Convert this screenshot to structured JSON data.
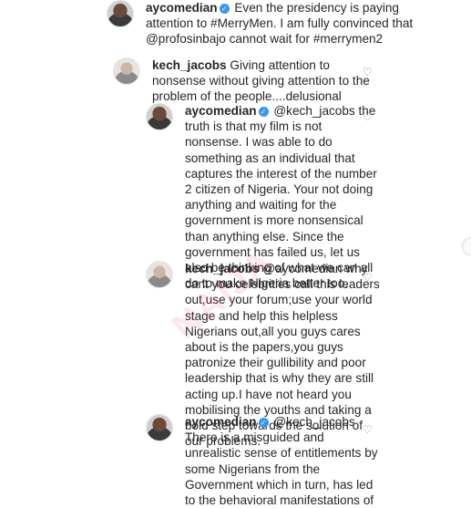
{
  "post": {
    "username": "aycomedian",
    "text": "Even the presidency is paying attention to #MerryMen. I am fully convinced that @profosinbajo cannot wait for #merrymen2"
  },
  "comments": [
    {
      "username": "kech_jacobs",
      "text": "Giving attention to nonsense without giving attention to the problem of the people....delusional"
    },
    {
      "username": "aycomedian",
      "text": "@kech_jacobs the truth is that my film is not nonsense. I was able to do something as an individual that captures the interest of the number 2 citizen of Nigeria. Your not doing anything and waiting for the government is more nonsensical than anything else. Since the government has failed us, let us also be thinking of what we can all do to make Nigeria better too."
    },
    {
      "username": "kech_jacobs",
      "text": "@aycomedian why cant you celebrities call this leaders out,use your forum;use your world stage and help this helpless Nigerians out,all you guys cares about is the papers,you guys patronize their gullibility and poor leadership that is why they are still acting up.I have not heard you mobilising the youths and taking a bold step towards the solution of our problems."
    },
    {
      "username": "aycomedian",
      "text": "@kech_jacobs There is a misguided and unrealistic sense of entitlements by some Nigerians from the Government which in turn, has led to the behavioral manifestations of"
    }
  ],
  "icons": {
    "verified": "verified-badge-icon",
    "like": "heart-icon"
  },
  "watermark": "NAIJA",
  "colors": {
    "verified": "#3897f0",
    "text": "#262626",
    "icon": "#8e8e8e"
  }
}
